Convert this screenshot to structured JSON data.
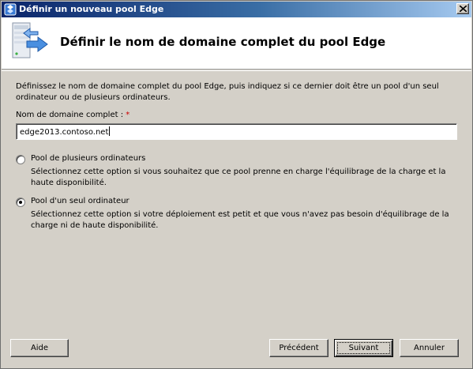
{
  "window": {
    "title": "Définir un nouveau pool Edge"
  },
  "header": {
    "title": "Définir le nom de domaine complet du pool Edge",
    "icon": "server-pool-arrow-icon"
  },
  "description": "Définissez le nom de domaine complet du pool Edge, puis indiquez si ce dernier doit être un pool d'un seul ordinateur ou de plusieurs ordinateurs.",
  "fqdn": {
    "label": "Nom de domaine complet :",
    "required_marker": "*",
    "value": "edge2013.contoso.net"
  },
  "options": [
    {
      "label": "Pool de plusieurs ordinateurs",
      "description": "Sélectionnez cette option si vous souhaitez que ce pool prenne en charge l'équilibrage de la charge et la haute disponibilité.",
      "selected": false
    },
    {
      "label": "Pool d'un seul ordinateur",
      "description": "Sélectionnez cette option si votre déploiement est petit et que vous n'avez pas besoin d'équilibrage de la charge ni de haute disponibilité.",
      "selected": true
    }
  ],
  "buttons": {
    "help": "Aide",
    "previous": "Précédent",
    "next": "Suivant",
    "cancel": "Annuler"
  },
  "colors": {
    "titlebar_start": "#0a246a",
    "titlebar_end": "#a6caf0",
    "dialog_bg": "#d4d0c8",
    "required": "#cc0000"
  }
}
